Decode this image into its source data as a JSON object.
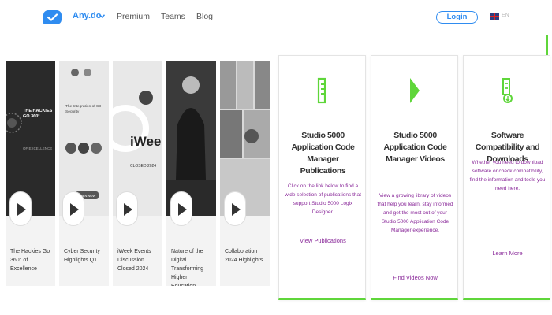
{
  "header": {
    "brand": "Any.do",
    "nav": [
      "Premium",
      "Teams",
      "Blog"
    ],
    "login": "Login",
    "language": "EN"
  },
  "webinars": [
    {
      "caption": "The Hackies Go 360° of Excellence",
      "thumb_title": "THE HACKIES GO 360°",
      "thumb_sub": "OF EXCELLENCE"
    },
    {
      "caption": "Cyber Security Highlights Q1",
      "thumb_title": "The Integration of C3 Security",
      "thumb_sub": "OPEN NOW"
    },
    {
      "caption": "iWeek Events Discussion Closed 2024",
      "thumb_title": "iWeek",
      "thumb_sub": "CLOSED 2024"
    },
    {
      "caption": "Nature of the Digital Transforming Higher Education",
      "thumb_title": "",
      "thumb_sub": ""
    },
    {
      "caption": "Collaboration 2024 Highlights",
      "thumb_title": "",
      "thumb_sub": ""
    }
  ],
  "cards": [
    {
      "title": "Studio 5000 Application Code Manager Publications",
      "desc": "Click on the link below to find a wide selection of publications that support Studio 5000 Logix Designer.",
      "link": "View Publications",
      "icon": "document-icon"
    },
    {
      "title": "Studio 5000 Application Code Manager Videos",
      "desc": "View a growing library of videos that help you learn, stay informed and get the most out of your Studio 5000 Application Code Manager experience.",
      "link": "Find Videos Now",
      "icon": "play-icon"
    },
    {
      "title": "Software Compatibility and Downloads",
      "desc": "Whether you need to download software or check compatibility, find the information and tools you need here.",
      "link": "Learn More",
      "icon": "download-icon"
    }
  ],
  "colors": {
    "brand_blue": "#2f8cf0",
    "accent_green": "#5fd63a",
    "link_purple": "#8a2a9a"
  }
}
